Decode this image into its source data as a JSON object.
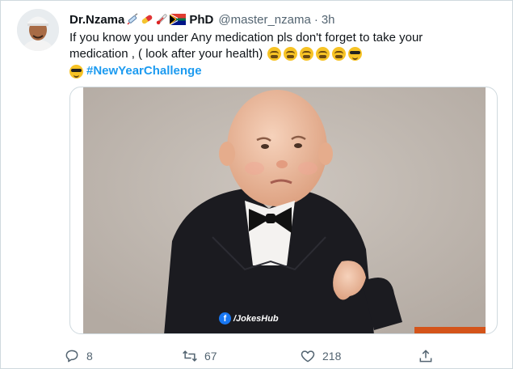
{
  "tweet": {
    "author": {
      "name": "Dr.Nzama",
      "name_suffix": "PhD",
      "handle": "@master_nzama",
      "separator": "·",
      "time": "3h",
      "name_emojis": [
        "syringe-icon",
        "pill-icon",
        "thermometer-icon",
        "south-africa-flag-icon"
      ]
    },
    "text": {
      "line1": "If you know you under Any medication pls don't forget to take your",
      "line2": "medication , ( look after your health)",
      "hashtag": "#NewYearChallenge"
    },
    "media": {
      "watermark": "/JokesHub",
      "watermark_icon": "f"
    },
    "actions": {
      "replies": "8",
      "retweets": "67",
      "likes": "218"
    }
  },
  "colors": {
    "accent": "#1d9bf0",
    "muted_text": "#536471",
    "border": "#cfd9de"
  }
}
